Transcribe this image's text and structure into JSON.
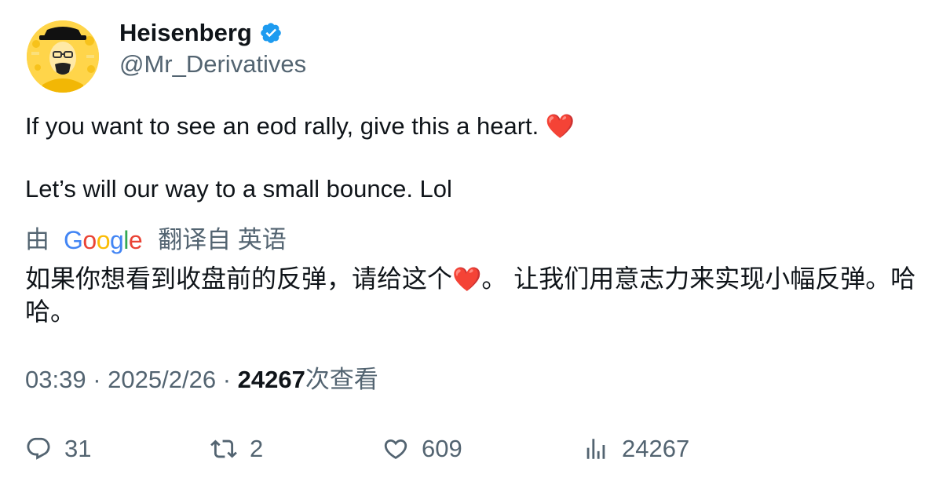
{
  "author": {
    "display_name": "Heisenberg",
    "handle": "@Mr_Derivatives",
    "verified_icon": "verified-badge-icon",
    "colors": {
      "verified": "#1d9bf0",
      "avatar_bg": "#ffd54a"
    }
  },
  "tweet": {
    "line1": "If you want to see an eod rally, give this a heart.",
    "line1_emoji": "❤️",
    "line2": "Let’s will our way to a small bounce. Lol"
  },
  "translation": {
    "prefix": "由",
    "provider": "Google",
    "suffix": "翻译自 英语",
    "text_part1": "如果你想看到收盘前的反弹，请给这个",
    "text_emoji": "❤️",
    "text_part2": "。 让我们用意志力来实现小幅反弹。哈哈。"
  },
  "meta": {
    "time": "03:39",
    "sep1": "·",
    "date": "2025/2/26",
    "sep2": "·",
    "views_count": "24267",
    "views_label": "次查看"
  },
  "actions": {
    "replies": "31",
    "retweets": "2",
    "likes": "609",
    "views": "24267"
  }
}
